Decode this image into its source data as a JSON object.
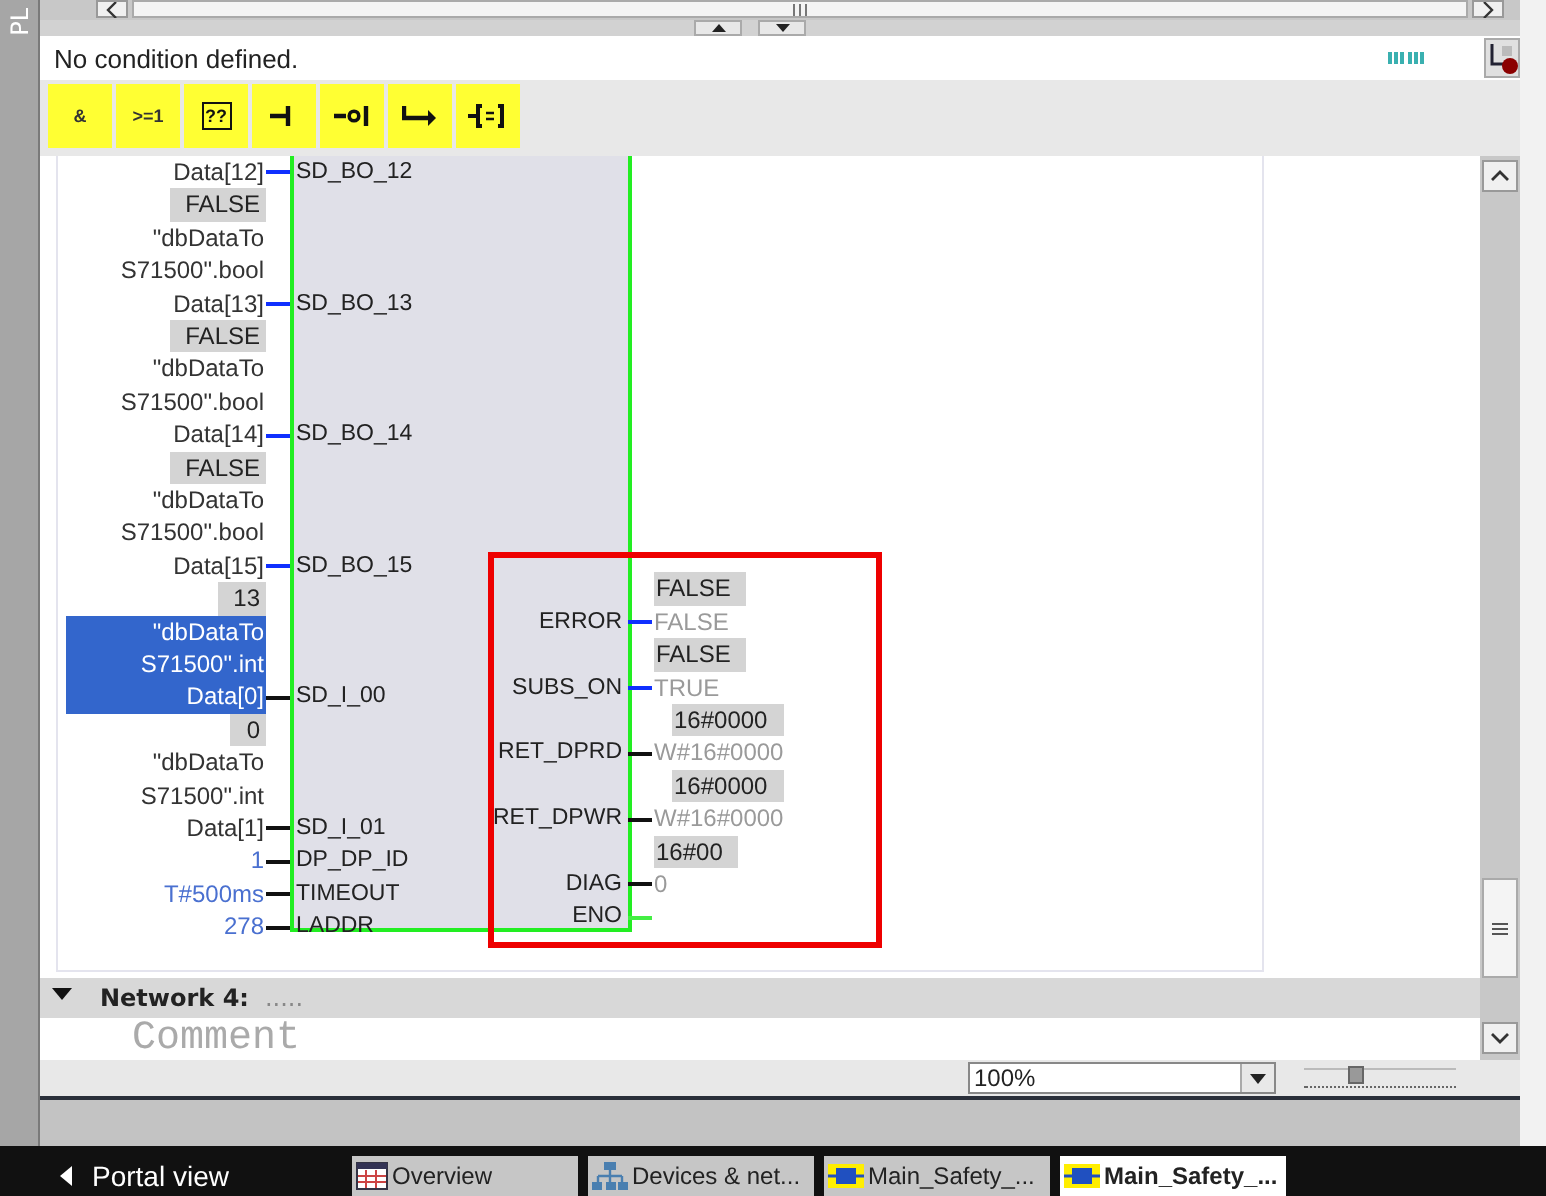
{
  "side_panel": {
    "label": "PL"
  },
  "condition_bar": {
    "text": "No condition defined."
  },
  "toolbar": [
    {
      "kind": "text",
      "label": "&"
    },
    {
      "kind": "text",
      "label": ">=1"
    },
    {
      "kind": "box",
      "label": "??"
    },
    {
      "kind": "contact"
    },
    {
      "kind": "negated"
    },
    {
      "kind": "branch"
    },
    {
      "kind": "assign"
    }
  ],
  "block": {
    "inputs": [
      {
        "pin": "SD_BO_12",
        "kind": "bool",
        "operand": [
          "Data[12]"
        ],
        "selected": false
      },
      {
        "pin": "SD_BO_13",
        "kind": "bool",
        "value": "FALSE",
        "operand": [
          "\"dbDataTo",
          "S71500\".bool",
          "Data[13]"
        ],
        "selected": false
      },
      {
        "pin": "SD_BO_14",
        "kind": "bool",
        "value": "FALSE",
        "operand": [
          "\"dbDataTo",
          "S71500\".bool",
          "Data[14]"
        ],
        "selected": false
      },
      {
        "pin": "SD_BO_15",
        "kind": "bool",
        "value": "FALSE",
        "operand": [
          "\"dbDataTo",
          "S71500\".bool",
          "Data[15]"
        ],
        "selected": false
      },
      {
        "pin": "SD_I_00",
        "kind": "word",
        "value": "13",
        "operand": [
          "\"dbDataTo",
          "S71500\".int",
          "Data[0]"
        ],
        "selected": true
      },
      {
        "pin": "SD_I_01",
        "kind": "word",
        "value": "0",
        "operand": [
          "\"dbDataTo",
          "S71500\".int",
          "Data[1]"
        ],
        "selected": false
      },
      {
        "pin": "DP_DP_ID",
        "kind": "constant",
        "operand": [
          "1"
        ],
        "selected": false
      },
      {
        "pin": "TIMEOUT",
        "kind": "constant",
        "operand": [
          "T#500ms"
        ],
        "selected": false
      },
      {
        "pin": "LADDR",
        "kind": "constant",
        "operand": [
          "278"
        ],
        "selected": false
      }
    ],
    "outputs": [
      {
        "pin": "ERROR",
        "kind": "bool",
        "value": "FALSE",
        "operand": "FALSE"
      },
      {
        "pin": "SUBS_ON",
        "kind": "bool",
        "value": "FALSE",
        "operand": "TRUE"
      },
      {
        "pin": "RET_DPRD",
        "kind": "word",
        "value": "16#0000",
        "operand": "W#16#0000"
      },
      {
        "pin": "RET_DPWR",
        "kind": "word",
        "value": "16#0000",
        "operand": "W#16#0000"
      },
      {
        "pin": "DIAG",
        "kind": "word",
        "value": "16#00",
        "operand": "0"
      },
      {
        "pin": "ENO",
        "kind": "eno"
      }
    ]
  },
  "network": {
    "title": "Network 4:",
    "marker": ".....",
    "comment": "Comment",
    "expanded": true
  },
  "zoom": {
    "value": "100%",
    "level": 0.34
  },
  "taskbar": {
    "portal": "Portal view",
    "tabs": [
      {
        "label": "Overview",
        "kind": "overview",
        "selected": false
      },
      {
        "label": "Devices & net...",
        "kind": "network",
        "selected": false
      },
      {
        "label": "Main_Safety_...",
        "kind": "block",
        "selected": false
      },
      {
        "label": "Main_Safety_...",
        "kind": "block",
        "selected": true
      }
    ]
  }
}
